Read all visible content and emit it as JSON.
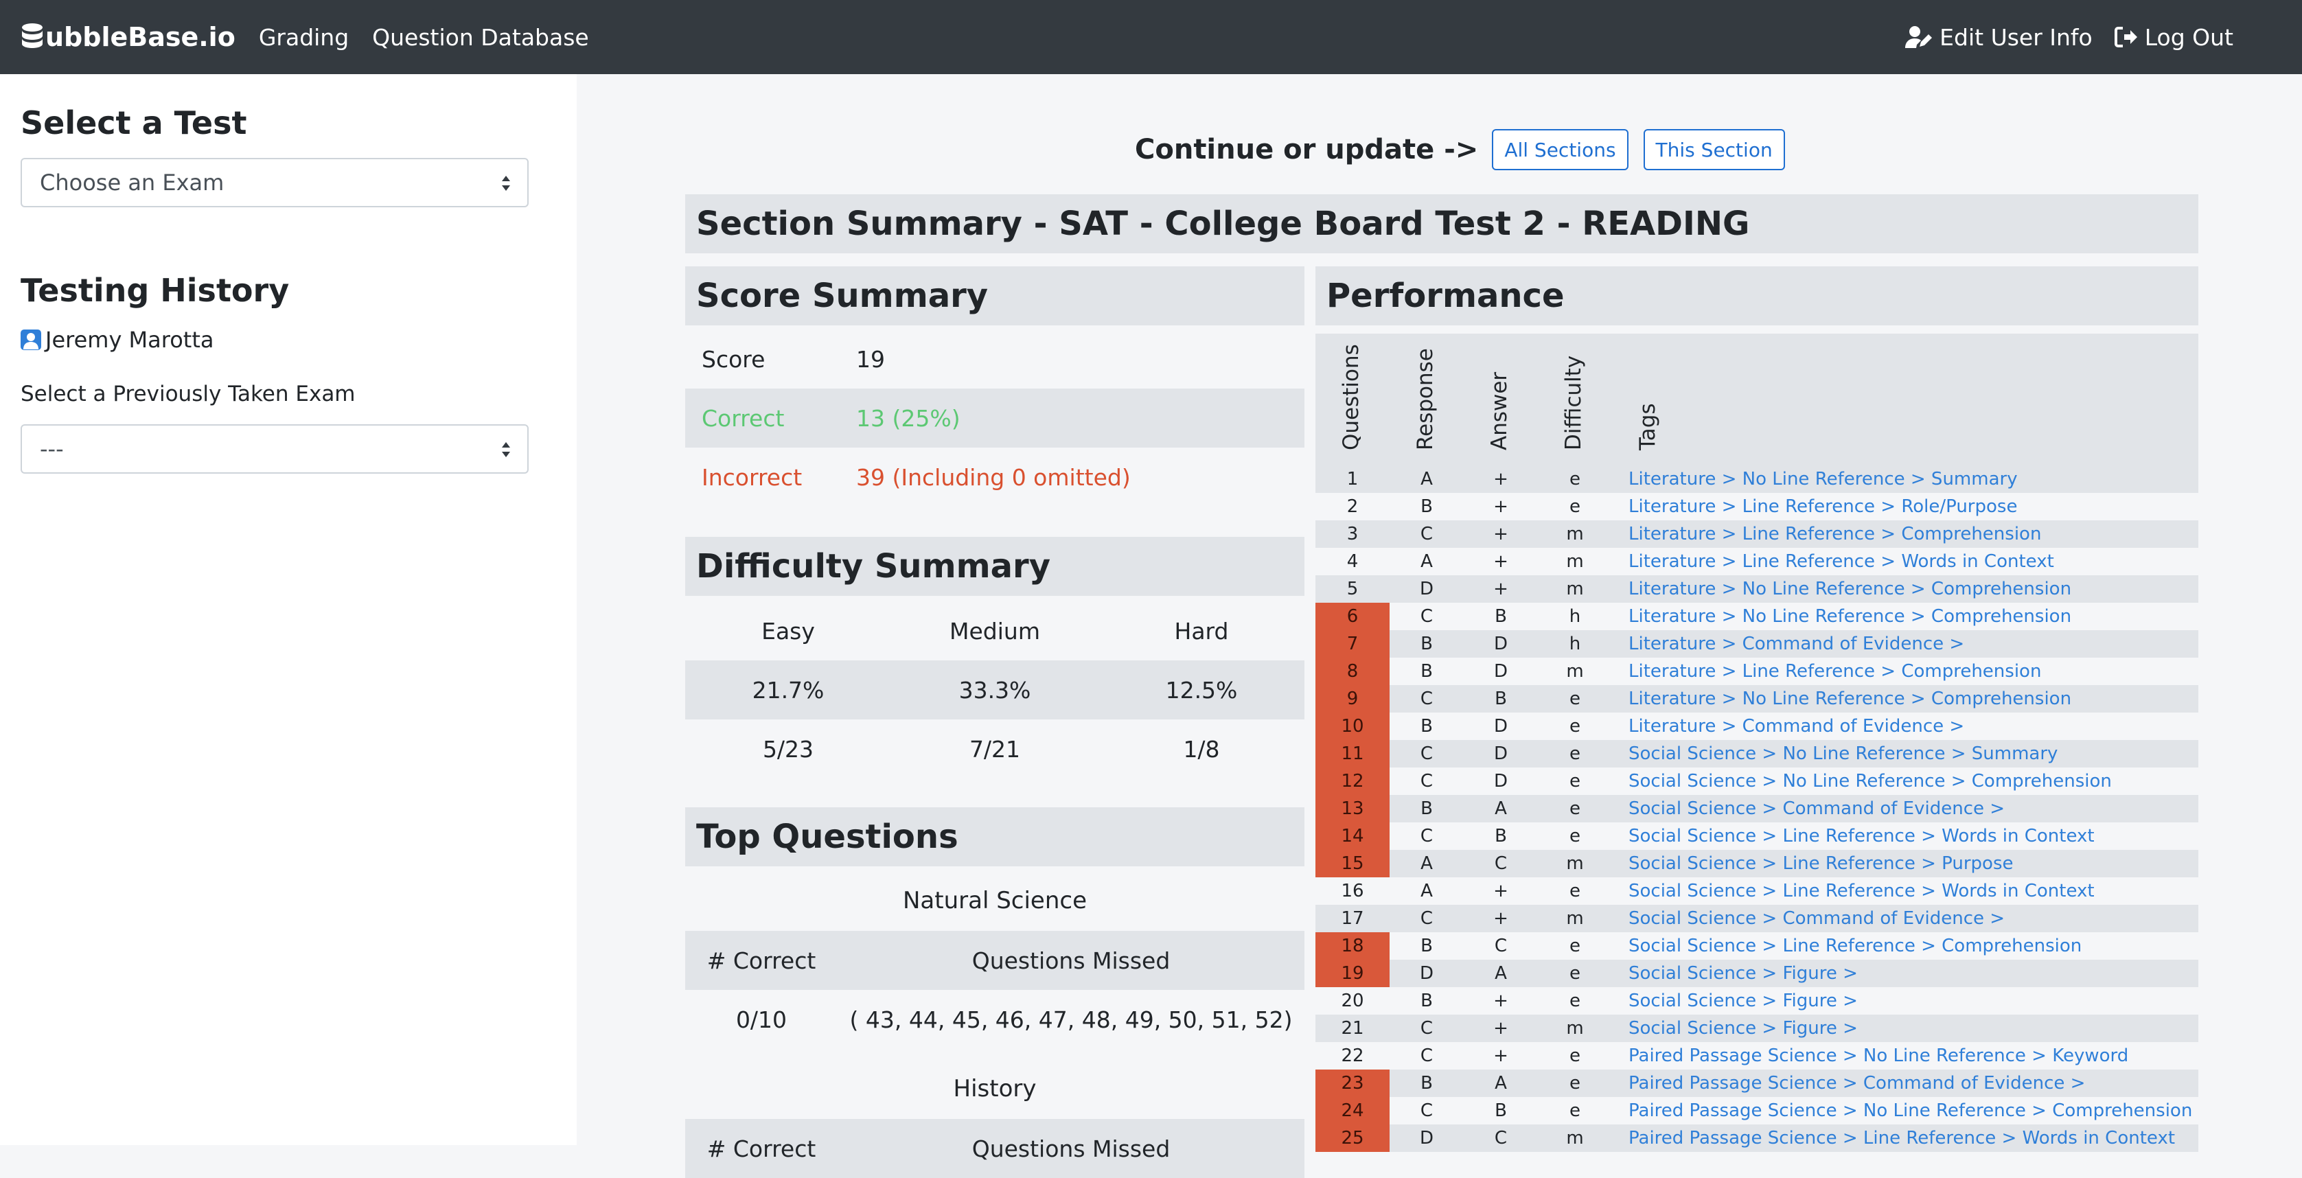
{
  "nav": {
    "brand": "ubbleBase.io",
    "links": [
      "Grading",
      "Question Database"
    ],
    "edit_user": "Edit User Info",
    "log_out": "Log Out"
  },
  "sidebar": {
    "select_test_heading": "Select a Test",
    "exam_select_value": "Choose an Exam",
    "history_heading": "Testing History",
    "user_name": "Jeremy Marotta",
    "prev_label": "Select a Previously Taken Exam",
    "prev_select_value": "---"
  },
  "main": {
    "continue_text": "Continue or update ->",
    "btn_all": "All Sections",
    "btn_this": "This Section",
    "section_title": "Section Summary - SAT - College Board Test 2 - READING",
    "score_summary": {
      "heading": "Score Summary",
      "score_label": "Score",
      "score_value": "19",
      "correct_label": "Correct",
      "correct_value": "13 (25%)",
      "incorrect_label": "Incorrect",
      "incorrect_value": "39 (Including 0 omitted)"
    },
    "difficulty_summary": {
      "heading": "Difficulty Summary",
      "cols": [
        "Easy",
        "Medium",
        "Hard"
      ],
      "percents": [
        "21.7%",
        "33.3%",
        "12.5%"
      ],
      "counts": [
        "5/23",
        "7/21",
        "1/8"
      ]
    },
    "top_questions": {
      "heading": "Top Questions",
      "groups": [
        {
          "name": "Natural Science",
          "col1": "# Correct",
          "col2": "Questions Missed",
          "correct": "0/10",
          "missed": "( 43, 44, 45, 46, 47, 48, 49, 50, 51, 52)"
        },
        {
          "name": "History",
          "col1": "# Correct",
          "col2": "Questions Missed"
        }
      ]
    },
    "performance": {
      "heading": "Performance",
      "columns": [
        "Questions",
        "Response",
        "Answer",
        "Difficulty",
        "Tags"
      ],
      "rows": [
        {
          "q": "1",
          "r": "A",
          "a": "+",
          "d": "e",
          "t": "Literature > No Line Reference > Summary",
          "miss": false
        },
        {
          "q": "2",
          "r": "B",
          "a": "+",
          "d": "e",
          "t": "Literature > Line Reference > Role/Purpose",
          "miss": false
        },
        {
          "q": "3",
          "r": "C",
          "a": "+",
          "d": "m",
          "t": "Literature > Line Reference > Comprehension",
          "miss": false
        },
        {
          "q": "4",
          "r": "A",
          "a": "+",
          "d": "m",
          "t": "Literature > Line Reference > Words in Context",
          "miss": false
        },
        {
          "q": "5",
          "r": "D",
          "a": "+",
          "d": "m",
          "t": "Literature > No Line Reference > Comprehension",
          "miss": false
        },
        {
          "q": "6",
          "r": "C",
          "a": "B",
          "d": "h",
          "t": "Literature > No Line Reference > Comprehension",
          "miss": true
        },
        {
          "q": "7",
          "r": "B",
          "a": "D",
          "d": "h",
          "t": "Literature > Command of Evidence >",
          "miss": true
        },
        {
          "q": "8",
          "r": "B",
          "a": "D",
          "d": "m",
          "t": "Literature > Line Reference > Comprehension",
          "miss": true
        },
        {
          "q": "9",
          "r": "C",
          "a": "B",
          "d": "e",
          "t": "Literature > No Line Reference > Comprehension",
          "miss": true
        },
        {
          "q": "10",
          "r": "B",
          "a": "D",
          "d": "e",
          "t": "Literature > Command of Evidence >",
          "miss": true
        },
        {
          "q": "11",
          "r": "C",
          "a": "D",
          "d": "e",
          "t": "Social Science > No Line Reference > Summary",
          "miss": true
        },
        {
          "q": "12",
          "r": "C",
          "a": "D",
          "d": "e",
          "t": "Social Science > No Line Reference > Comprehension",
          "miss": true
        },
        {
          "q": "13",
          "r": "B",
          "a": "A",
          "d": "e",
          "t": "Social Science > Command of Evidence >",
          "miss": true
        },
        {
          "q": "14",
          "r": "C",
          "a": "B",
          "d": "e",
          "t": "Social Science > Line Reference > Words in Context",
          "miss": true
        },
        {
          "q": "15",
          "r": "A",
          "a": "C",
          "d": "m",
          "t": "Social Science > Line Reference > Purpose",
          "miss": true
        },
        {
          "q": "16",
          "r": "A",
          "a": "+",
          "d": "e",
          "t": "Social Science > Line Reference > Words in Context",
          "miss": false
        },
        {
          "q": "17",
          "r": "C",
          "a": "+",
          "d": "m",
          "t": "Social Science > Command of Evidence >",
          "miss": false
        },
        {
          "q": "18",
          "r": "B",
          "a": "C",
          "d": "e",
          "t": "Social Science > Line Reference > Comprehension",
          "miss": true
        },
        {
          "q": "19",
          "r": "D",
          "a": "A",
          "d": "e",
          "t": "Social Science > Figure >",
          "miss": true
        },
        {
          "q": "20",
          "r": "B",
          "a": "+",
          "d": "e",
          "t": "Social Science > Figure >",
          "miss": false
        },
        {
          "q": "21",
          "r": "C",
          "a": "+",
          "d": "m",
          "t": "Social Science > Figure >",
          "miss": false
        },
        {
          "q": "22",
          "r": "C",
          "a": "+",
          "d": "e",
          "t": "Paired Passage Science > No Line Reference > Keyword",
          "miss": false
        },
        {
          "q": "23",
          "r": "B",
          "a": "A",
          "d": "e",
          "t": "Paired Passage Science > Command of Evidence >",
          "miss": true
        },
        {
          "q": "24",
          "r": "C",
          "a": "B",
          "d": "e",
          "t": "Paired Passage Science > No Line Reference > Comprehension",
          "miss": true
        },
        {
          "q": "25",
          "r": "D",
          "a": "C",
          "d": "m",
          "t": "Paired Passage Science > Line Reference > Words in Context",
          "miss": true
        }
      ]
    }
  },
  "colors": {
    "navbar": "#343a40",
    "accent": "#1f6fd1",
    "correct": "#5cc873",
    "incorrect": "#d9502f",
    "missed_cell": "#d9583a",
    "tag_link": "#2f7fd8"
  }
}
